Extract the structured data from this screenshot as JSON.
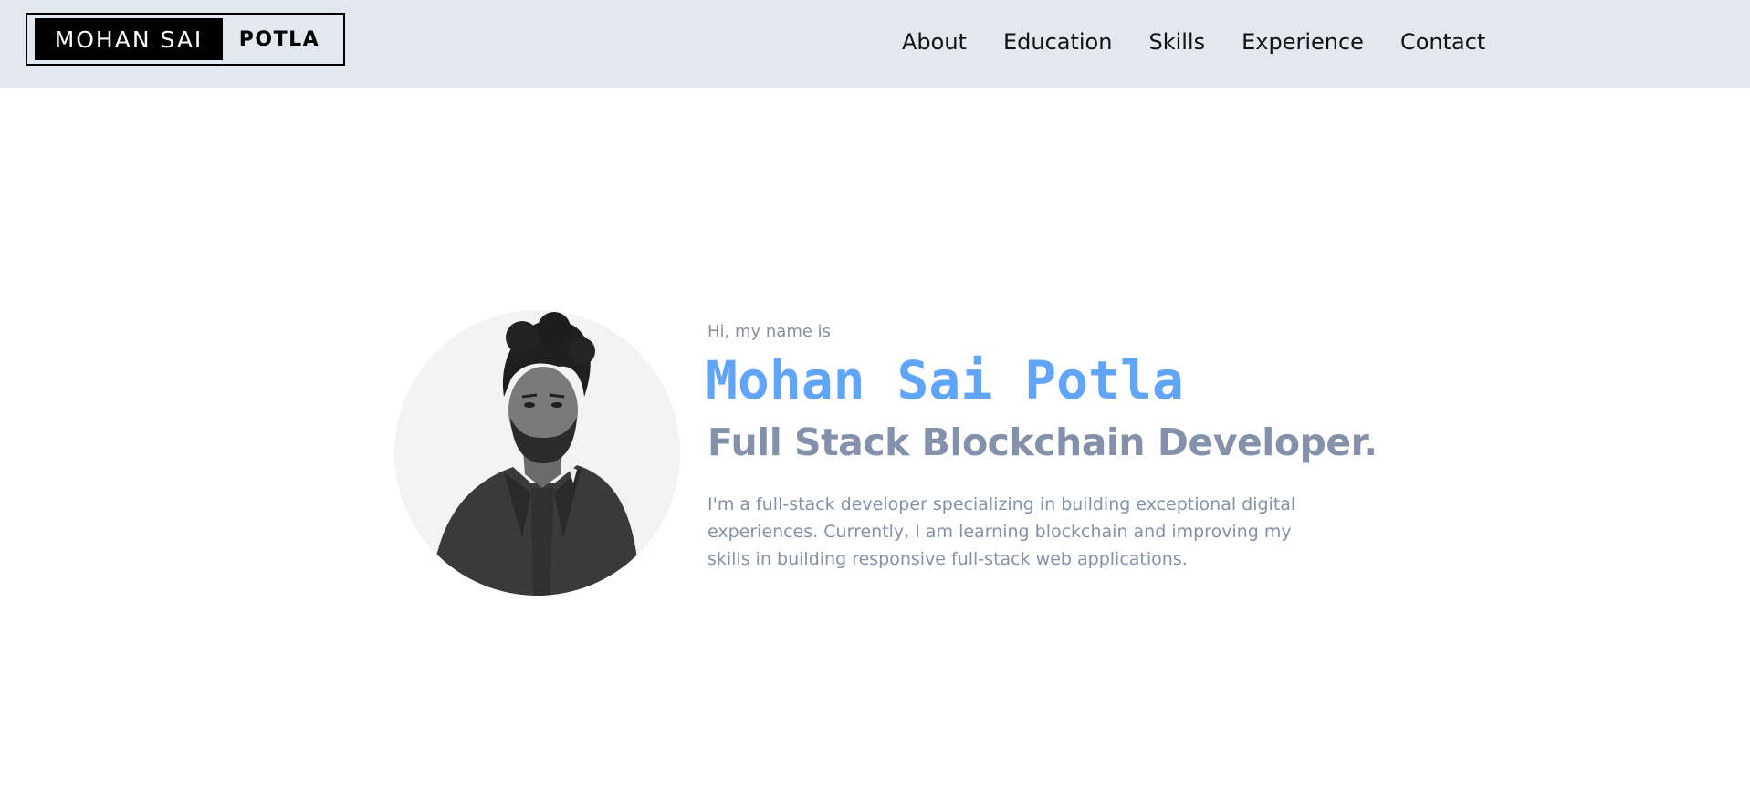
{
  "header": {
    "logo_left": "MOHAN SAI",
    "logo_right": "POTLA",
    "nav": [
      "About",
      "Education",
      "Skills",
      "Experience",
      "Contact"
    ]
  },
  "hero": {
    "greeting": "Hi, my name is",
    "name": "Mohan Sai Potla",
    "role": "Full Stack Blockchain Developer.",
    "description": "I'm a full-stack developer specializing in building exceptional digital experiences. Currently, I am learning blockchain and improving my skills in building responsive full-stack web applications.",
    "avatar_alt": "profile-photo"
  },
  "colors": {
    "nav_bg": "#e2e8f0",
    "name": "#60a5fa",
    "role": "#8590aa",
    "muted": "#8a8f98"
  }
}
